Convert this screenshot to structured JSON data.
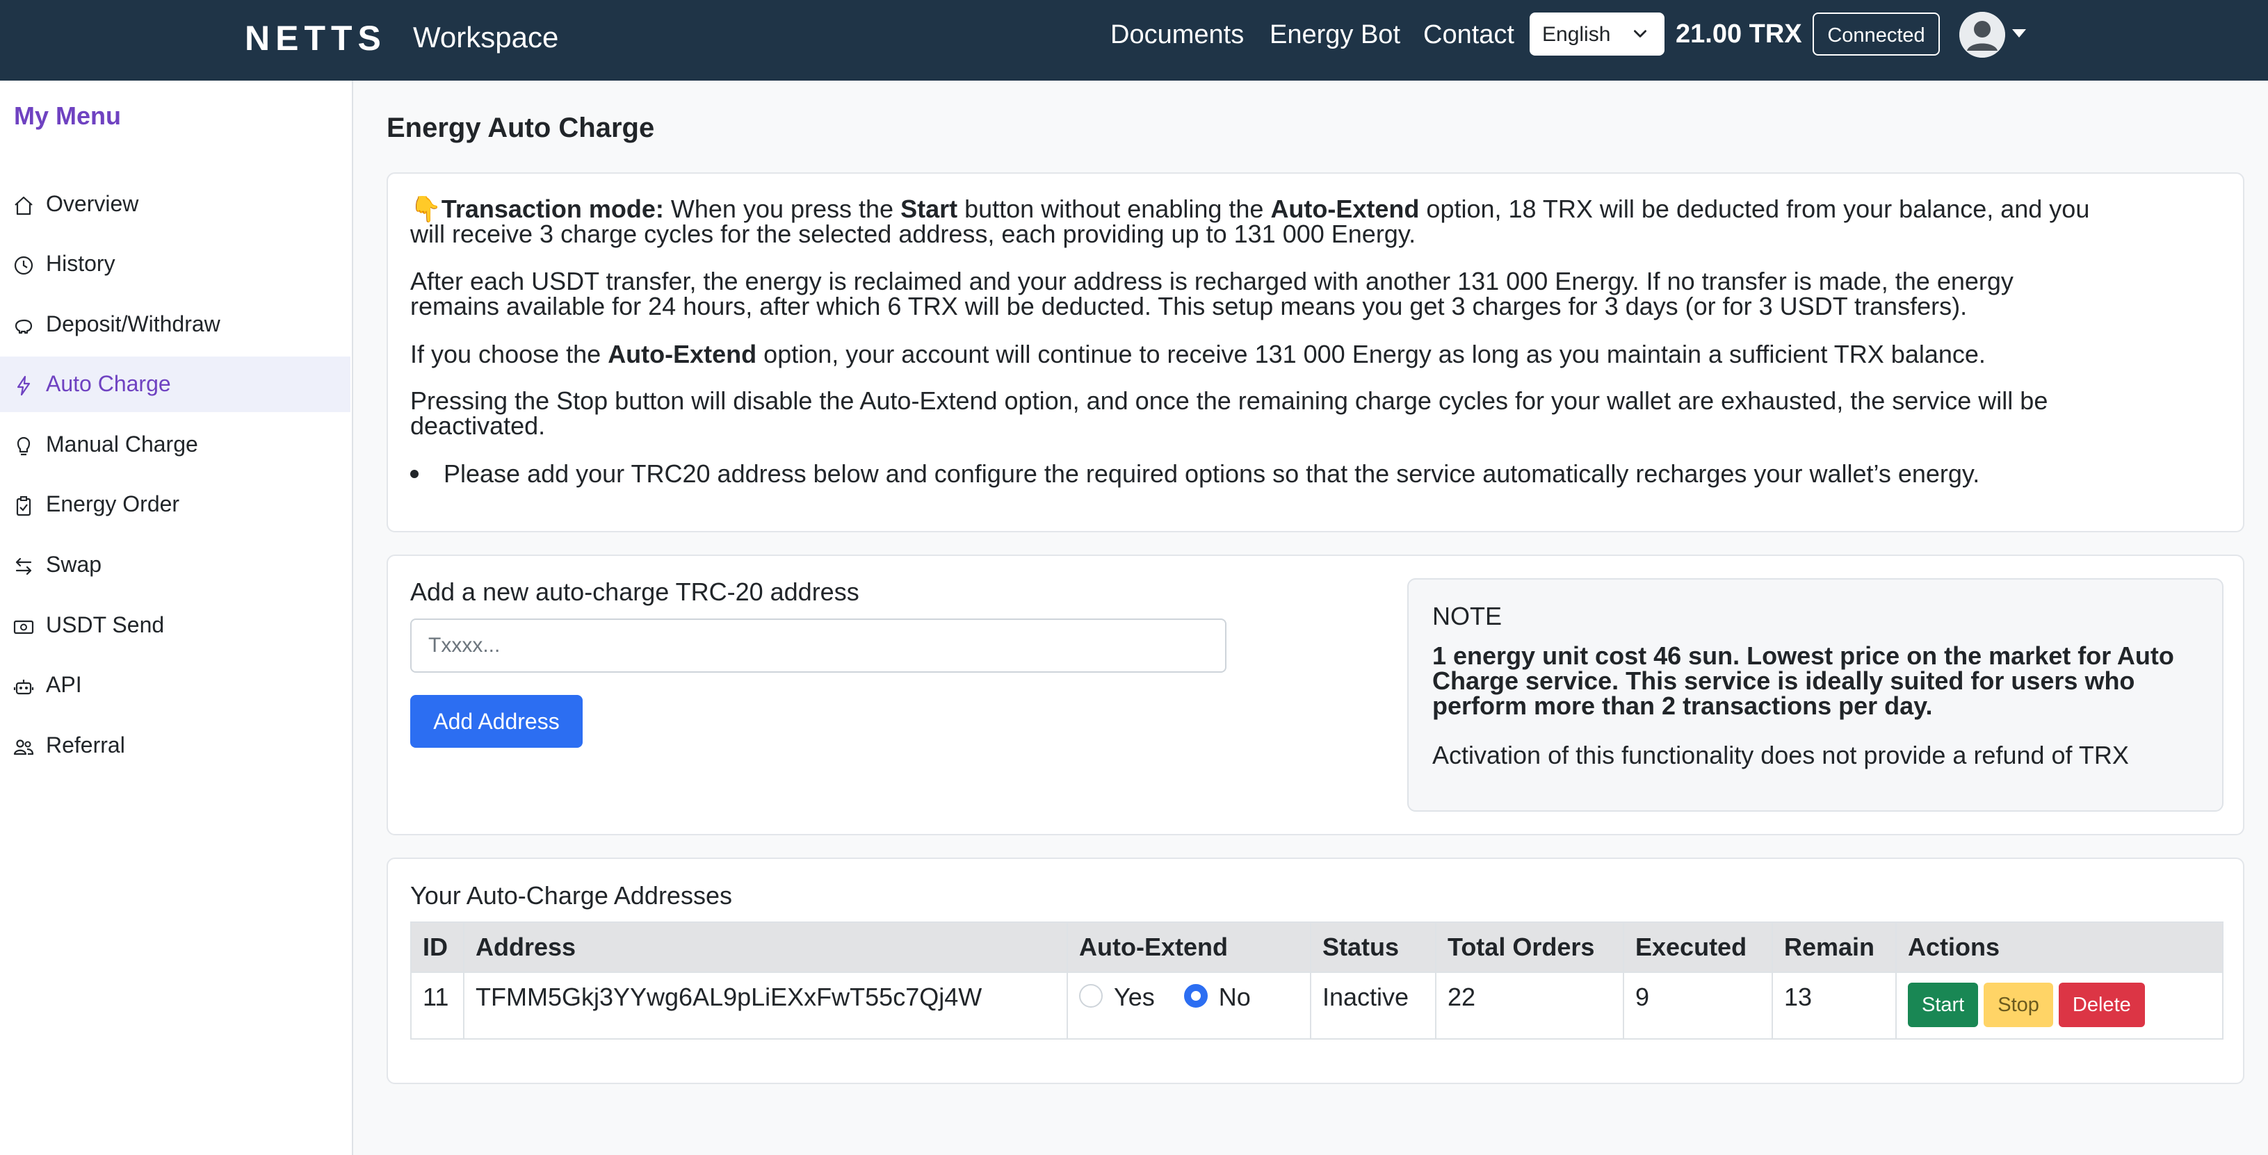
{
  "header": {
    "brand": "NETTS",
    "brand_sub": "Workspace",
    "nav": [
      "Documents",
      "Energy Bot",
      "Contact"
    ],
    "language": "English",
    "balance": "21.00 TRX",
    "status_button": "Connected"
  },
  "sidebar": {
    "title": "My Menu",
    "items": [
      {
        "label": "Overview",
        "icon": "home-icon"
      },
      {
        "label": "History",
        "icon": "clock-icon"
      },
      {
        "label": "Deposit/Withdraw",
        "icon": "piggy-bank-icon"
      },
      {
        "label": "Auto Charge",
        "icon": "lightning-icon",
        "active": true
      },
      {
        "label": "Manual Charge",
        "icon": "lightbulb-icon"
      },
      {
        "label": "Energy Order",
        "icon": "clipboard-check-icon"
      },
      {
        "label": "Swap",
        "icon": "swap-arrows-icon"
      },
      {
        "label": "USDT Send",
        "icon": "cash-icon"
      },
      {
        "label": "API",
        "icon": "robot-icon"
      },
      {
        "label": "Referral",
        "icon": "people-icon"
      }
    ]
  },
  "page": {
    "title": "Energy Auto Charge"
  },
  "info": {
    "p1_icon": "👇",
    "p1_b1": "Transaction mode:",
    "p1_t1": " When you press the ",
    "p1_b2": "Start",
    "p1_t2": " button without enabling the ",
    "p1_b3": "Auto-Extend",
    "p1_t3": " option, 18 TRX will be deducted from your balance, and you",
    "p1_line2": "will receive 3 charge cycles for the selected address, each providing up to 131 000 Energy.",
    "p2_line1": "After each USDT transfer, the energy is reclaimed and your address is recharged with another 131 000 Energy. If no transfer is made, the energy",
    "p2_line2": "remains available for 24 hours, after which 6 TRX will be deducted. This setup means you get 3 charges for 3 days (or for 3 USDT transfers).",
    "p3_t1": "If you choose the ",
    "p3_b1": "Auto-Extend",
    "p3_t2": " option, your account will continue to receive 131 000 Energy as long as you maintain a sufficient TRX balance.",
    "p4_line1": "Pressing the Stop button will disable the Auto-Extend option, and once the remaining charge cycles for your wallet are exhausted, the service will be",
    "p4_line2": "deactivated.",
    "bullet": "Please add your TRC20 address below and configure the required options so that the service automatically recharges your wallet’s energy."
  },
  "add_form": {
    "label": "Add a new auto-charge TRC-20 address",
    "placeholder": "Txxxx...",
    "value": "",
    "button": "Add Address"
  },
  "note": {
    "title": "NOTE",
    "bold": "1 energy unit cost 46 sun. Lowest price on the market for Auto Charge service. This service is ideally suited for users who perform more than 2 transactions per day.",
    "plain": "Activation of this functionality does not provide a refund of TRX"
  },
  "addresses_table": {
    "title": "Your Auto-Charge Addresses",
    "columns": [
      "ID",
      "Address",
      "Auto-Extend",
      "Status",
      "Total Orders",
      "Executed",
      "Remain",
      "Actions"
    ],
    "rows": [
      {
        "id": "11",
        "address": "TFMM5Gkj3YYwg6AL9pLiEXxFwT55c7Qj4W",
        "auto_extend_options": [
          "Yes",
          "No"
        ],
        "auto_extend": "No",
        "status": "Inactive",
        "total_orders": "22",
        "executed": "9",
        "remain": "13",
        "actions": [
          "Start",
          "Stop",
          "Delete"
        ]
      }
    ]
  },
  "colors": {
    "header_bg": "#1f3447",
    "accent_purple": "#6f42c1",
    "primary_blue": "#2c6ef2",
    "start_green": "#198754",
    "stop_yellow": "#ffd466",
    "delete_red": "#dc3545"
  }
}
